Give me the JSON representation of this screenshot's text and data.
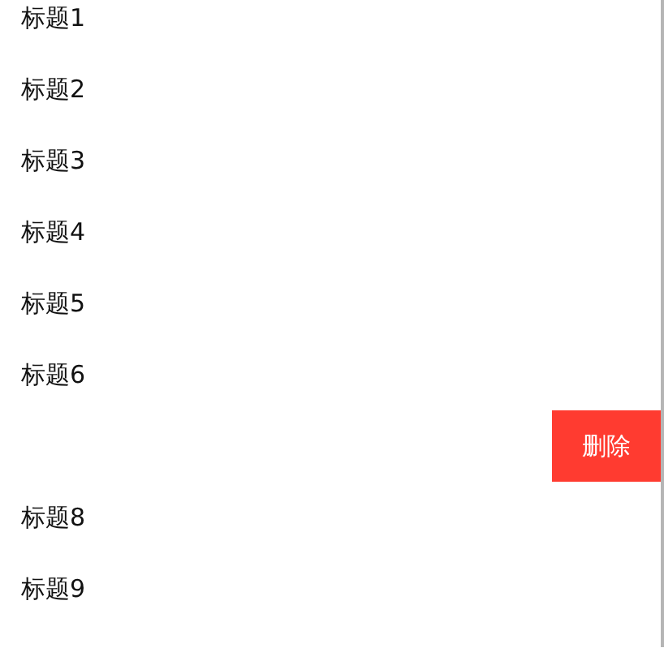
{
  "list": {
    "items": [
      {
        "title": "标题1",
        "swiped": false
      },
      {
        "title": "标题2",
        "swiped": false
      },
      {
        "title": "标题3",
        "swiped": false
      },
      {
        "title": "标题4",
        "swiped": false
      },
      {
        "title": "标题5",
        "swiped": false
      },
      {
        "title": "标题6",
        "swiped": false
      },
      {
        "swiped": true,
        "action": "删除"
      },
      {
        "title": "标题8",
        "swiped": false
      },
      {
        "title": "标题9",
        "swiped": false
      }
    ]
  }
}
